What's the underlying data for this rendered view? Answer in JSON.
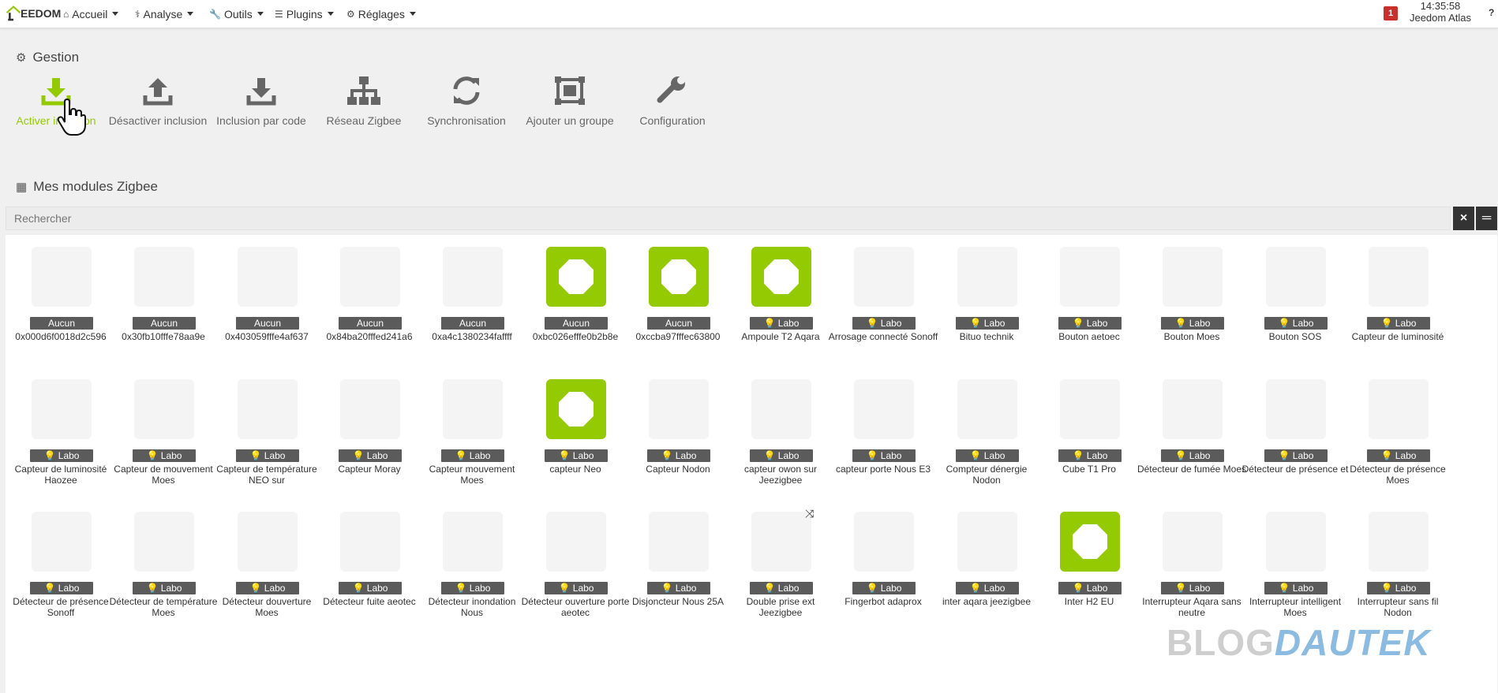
{
  "navbar": {
    "brand": "EEDOM",
    "items": [
      "Accueil",
      "Analyse",
      "Outils",
      "Plugins",
      "Réglages"
    ],
    "notification_count": "1",
    "time": "14:35:58",
    "system_name": "Jeedom Atlas",
    "help": "?"
  },
  "gestion": {
    "title": "Gestion",
    "actions": [
      {
        "label": "Activer inclusion",
        "icon": "download-icon"
      },
      {
        "label": "Désactiver inclusion",
        "icon": "upload-icon"
      },
      {
        "label": "Inclusion par code",
        "icon": "download-icon"
      },
      {
        "label": "Réseau Zigbee",
        "icon": "sitemap-icon"
      },
      {
        "label": "Synchronisation",
        "icon": "sync-icon"
      },
      {
        "label": "Ajouter un groupe",
        "icon": "object-group-icon"
      },
      {
        "label": "Configuration",
        "icon": "wrench-icon"
      }
    ]
  },
  "modules": {
    "title": "Mes modules Zigbee",
    "search_placeholder": "Rechercher",
    "rows": [
      [
        {
          "tag": "Aucun",
          "name": "0x000d6f0018d2c596",
          "img": "ph"
        },
        {
          "tag": "Aucun",
          "name": "0x30fb10fffe78aa9e",
          "img": "ph"
        },
        {
          "tag": "Aucun",
          "name": "0x403059fffe4af637",
          "img": "ph"
        },
        {
          "tag": "Aucun",
          "name": "0x84ba20fffed241a6",
          "img": "ph"
        },
        {
          "tag": "Aucun",
          "name": "0xa4c1380234faffff",
          "img": "ph"
        },
        {
          "tag": "Aucun",
          "name": "0xbc026efffe0b2b8e",
          "img": "mqtt"
        },
        {
          "tag": "Aucun",
          "name": "0xccba97fffec63800",
          "img": "mqtt"
        },
        {
          "tag": "Labo",
          "name": "Ampoule T2 Aqara",
          "img": "mqtt"
        },
        {
          "tag": "Labo",
          "name": "Arrosage connecté Sonoff",
          "img": "ph"
        },
        {
          "tag": "Labo",
          "name": "Bituo technik",
          "img": "ph"
        },
        {
          "tag": "Labo",
          "name": "Bouton aetoec",
          "img": "ph"
        },
        {
          "tag": "Labo",
          "name": "Bouton Moes",
          "img": "ph"
        },
        {
          "tag": "Labo",
          "name": "Bouton SOS",
          "img": "ph"
        },
        {
          "tag": "Labo",
          "name": "Capteur de luminosité",
          "img": "ph"
        }
      ],
      [
        {
          "tag": "Labo",
          "name": "Capteur de luminosité Haozee",
          "img": "ph"
        },
        {
          "tag": "Labo",
          "name": "Capteur de mouvement Moes",
          "img": "ph"
        },
        {
          "tag": "Labo",
          "name": "Capteur de température NEO sur",
          "img": "ph"
        },
        {
          "tag": "Labo",
          "name": "Capteur Moray",
          "img": "ph"
        },
        {
          "tag": "Labo",
          "name": "Capteur mouvement Moes",
          "img": "ph"
        },
        {
          "tag": "Labo",
          "name": "capteur Neo",
          "img": "mqtt"
        },
        {
          "tag": "Labo",
          "name": "Capteur Nodon",
          "img": "ph"
        },
        {
          "tag": "Labo",
          "name": "capteur owon sur Jeezigbee",
          "img": "ph"
        },
        {
          "tag": "Labo",
          "name": "capteur porte Nous E3",
          "img": "ph"
        },
        {
          "tag": "Labo",
          "name": "Compteur dénergie Nodon",
          "img": "ph"
        },
        {
          "tag": "Labo",
          "name": "Cube T1 Pro",
          "img": "ph"
        },
        {
          "tag": "Labo",
          "name": "Détecteur de fumée Moes",
          "img": "ph"
        },
        {
          "tag": "Labo",
          "name": "Détecteur de présence et",
          "img": "ph"
        },
        {
          "tag": "Labo",
          "name": "Détecteur de présence Moes",
          "img": "ph"
        }
      ],
      [
        {
          "tag": "Labo",
          "name": "Détecteur de présence Sonoff",
          "img": "ph"
        },
        {
          "tag": "Labo",
          "name": "Détecteur de température Moes",
          "img": "ph"
        },
        {
          "tag": "Labo",
          "name": "Détecteur douverture Moes",
          "img": "ph"
        },
        {
          "tag": "Labo",
          "name": "Détecteur fuite aeotec",
          "img": "ph"
        },
        {
          "tag": "Labo",
          "name": "Détecteur inondation Nous",
          "img": "ph"
        },
        {
          "tag": "Labo",
          "name": "Détecteur ouverture porte aeotec",
          "img": "ph"
        },
        {
          "tag": "Labo",
          "name": "Disjoncteur Nous 25A",
          "img": "ph"
        },
        {
          "tag": "Labo",
          "name": "Double prise ext Jeezigbee",
          "img": "ph"
        },
        {
          "tag": "Labo",
          "name": "Fingerbot adaprox",
          "img": "ph"
        },
        {
          "tag": "Labo",
          "name": "inter aqara jeezigbee",
          "img": "ph"
        },
        {
          "tag": "Labo",
          "name": "Inter H2 EU",
          "img": "mqtt"
        },
        {
          "tag": "Labo",
          "name": "Interrupteur Aqara sans neutre",
          "img": "ph"
        },
        {
          "tag": "Labo",
          "name": "Interrupteur intelligent Moes",
          "img": "ph"
        },
        {
          "tag": "Labo",
          "name": "Interrupteur sans fil Nodon",
          "img": "ph"
        }
      ]
    ]
  },
  "watermark": {
    "part1": "BLOG",
    "part2": "DAUTEK"
  },
  "colors": {
    "accent": "#94ca02",
    "label_bg": "#5b5b5b",
    "danger": "#c9302c",
    "search_btn": "#333333"
  }
}
